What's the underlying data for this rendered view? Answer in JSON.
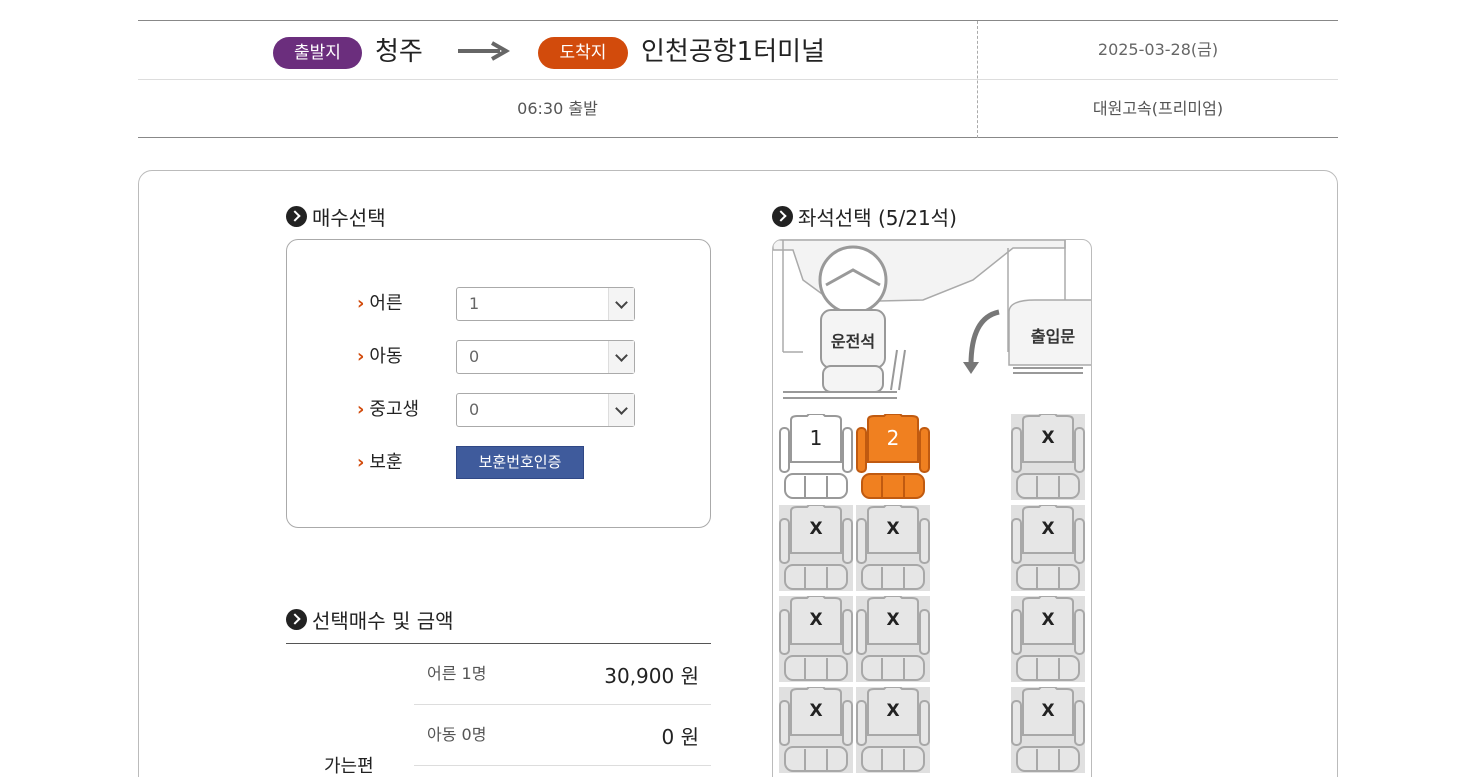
{
  "route": {
    "departure_badge": "출발지",
    "departure_city": "청주",
    "arrival_badge": "도착지",
    "arrival_city": "인천공항1터미널",
    "date": "2025-03-28(금)",
    "time": "06:30 출발",
    "company": "대원고속(프리미엄)"
  },
  "colors": {
    "departure": "#6b2e7d",
    "arrival": "#d24b0c",
    "selected_seat": "#f08020",
    "verify_button": "#3f5b9c"
  },
  "tickets": {
    "title": "매수선택",
    "rows": [
      {
        "label": "어른",
        "value": "1"
      },
      {
        "label": "아동",
        "value": "0"
      },
      {
        "label": "중고생",
        "value": "0"
      }
    ],
    "veteran_label": "보훈",
    "veteran_button": "보훈번호인증"
  },
  "summary": {
    "title": "선택매수 및 금액",
    "way_label": "가는편",
    "rows": [
      {
        "label": "어른 1명",
        "amount": "30,900 원"
      },
      {
        "label": "아동 0명",
        "amount": "0 원"
      }
    ]
  },
  "seats": {
    "title": "좌석선택 (5/21석)",
    "driver_label": "운전석",
    "door_label": "출입문",
    "list": [
      {
        "label": "1",
        "state": "available"
      },
      {
        "label": "2",
        "state": "selected"
      },
      {
        "label": "X",
        "state": "taken"
      },
      {
        "label": "X",
        "state": "taken"
      },
      {
        "label": "X",
        "state": "taken"
      },
      {
        "label": "X",
        "state": "taken"
      },
      {
        "label": "X",
        "state": "taken"
      },
      {
        "label": "X",
        "state": "taken"
      },
      {
        "label": "X",
        "state": "taken"
      },
      {
        "label": "X",
        "state": "taken"
      },
      {
        "label": "X",
        "state": "taken"
      },
      {
        "label": "X",
        "state": "taken"
      }
    ]
  }
}
